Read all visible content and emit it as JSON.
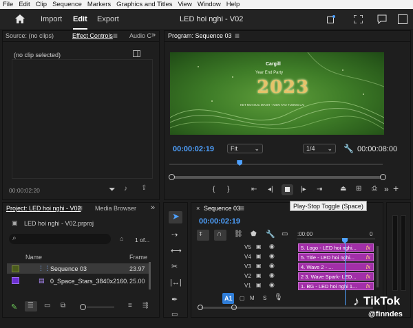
{
  "menu": [
    "File",
    "Edit",
    "Clip",
    "Sequence",
    "Markers",
    "Graphics and Titles",
    "View",
    "Window",
    "Help"
  ],
  "header": {
    "home_icon": "home-icon",
    "tabs": [
      "Import",
      "Edit",
      "Export"
    ],
    "active_tab": "Edit",
    "title": "LED hoi nghi - V02"
  },
  "source_panel": {
    "tabs": [
      "Source: (no clips)",
      "Effect Controls",
      "Audio C"
    ],
    "empty_text": "(no clip selected)",
    "timecode": "00:00:02:20"
  },
  "program": {
    "tab": "Program: Sequence 03",
    "video": {
      "brand": "Cargill",
      "line": "Year End Party",
      "year": "2023",
      "sub": "KET NOI SUC MANH - KIEN TAO TUONG LAI"
    },
    "timecode": "00:00:02:19",
    "fit": "Fit",
    "resolution": "1/4",
    "duration": "00:00:08:00",
    "playhead_fraction": 0.33
  },
  "project": {
    "tabs": [
      "Project: LED hoi nghi - V02",
      "Media Browser"
    ],
    "file": "LED hoi nghi - V02.prproj",
    "search_placeholder": "",
    "count": "1 of...",
    "columns": [
      "Name",
      "Frame"
    ],
    "items": [
      {
        "name": "Sequence 03",
        "frame": "23.97",
        "color": "#4a5b1c"
      },
      {
        "name": "0_Space_Stars_3840x2160.",
        "frame": "25.00",
        "color": "#6b2fd0"
      }
    ]
  },
  "timeline": {
    "tab": "Sequence 03",
    "timecode": "00:00:02:19",
    "ruler_start": ":00:00",
    "ruler_end": "0",
    "tracks": [
      {
        "id": "V5",
        "clip": "5. Logo - LED hoi nghi..."
      },
      {
        "id": "V4",
        "clip": "5. Title - LED hoi nghi..."
      },
      {
        "id": "V3",
        "clip": "4. Wave 2 - ..."
      },
      {
        "id": "V2",
        "clip": "2 3. Wave Spark- LED..."
      },
      {
        "id": "V1",
        "clip": "1. BG - LED hoi nghi 1..."
      }
    ],
    "audio_track": "A1",
    "audio_labels": [
      "M",
      "S"
    ],
    "fx_label": "fx"
  },
  "tooltip": "Play-Stop Toggle (Space)",
  "watermark": {
    "brand": "TikTok",
    "handle": "@finndes"
  }
}
